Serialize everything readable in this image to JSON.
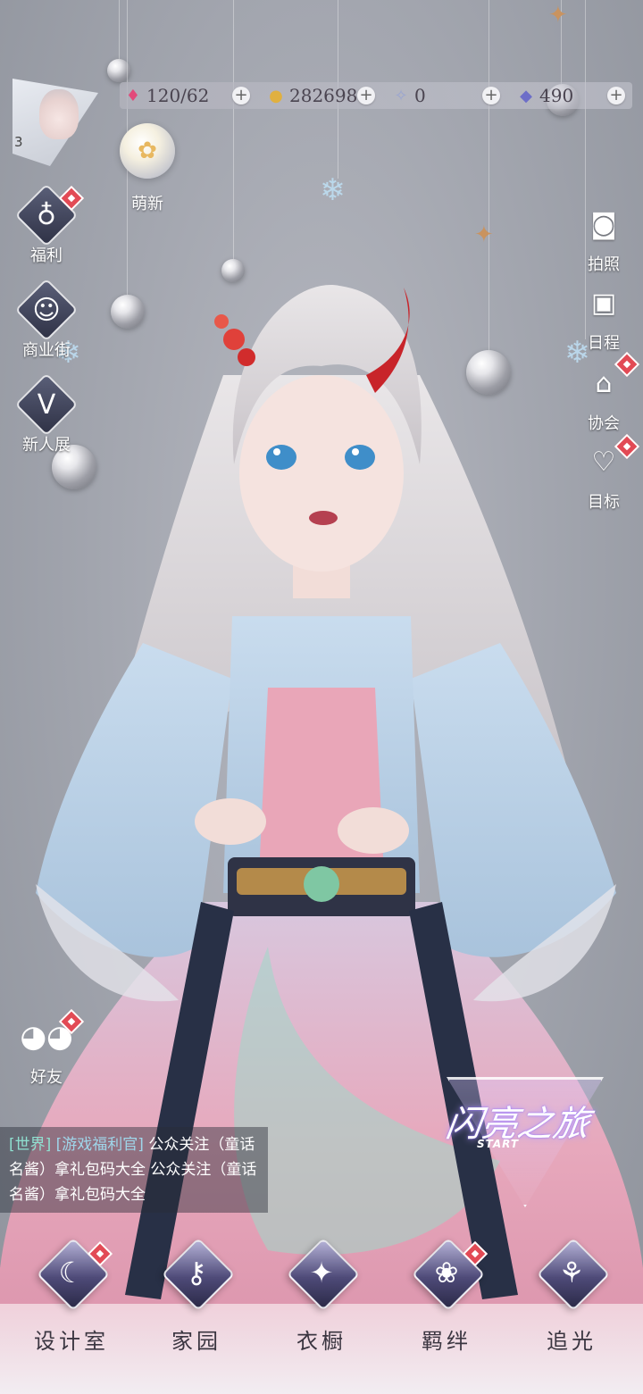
{
  "resources": {
    "stamina": {
      "icon": "heart-gem-icon",
      "value": "120/62"
    },
    "gold": {
      "icon": "gold-coin-icon",
      "value": "282698"
    },
    "crystal": {
      "icon": "crystal-icon",
      "value": "0"
    },
    "diamond": {
      "icon": "diamond-icon",
      "value": "490"
    },
    "plus": "+"
  },
  "player": {
    "level": "3"
  },
  "mengxin": {
    "label": "萌新"
  },
  "left_menu": [
    {
      "id": "fuli",
      "label": "福利",
      "icon": "hot-air-balloon-icon",
      "badge": true
    },
    {
      "id": "shangyejie",
      "label": "商业街",
      "icon": "shopping-bag-icon",
      "badge": false
    },
    {
      "id": "xinrenzhan",
      "label": "新人展",
      "icon": "trophy-v-icon",
      "badge": false
    }
  ],
  "right_menu": [
    {
      "id": "paizhao",
      "label": "拍照",
      "icon": "camera-icon",
      "badge": false
    },
    {
      "id": "richeng",
      "label": "日程",
      "icon": "calendar-icon",
      "badge": false
    },
    {
      "id": "xiehui",
      "label": "协会",
      "icon": "guild-hall-icon",
      "badge": true
    },
    {
      "id": "mubiao",
      "label": "目标",
      "icon": "bell-heart-icon",
      "badge": true
    }
  ],
  "friends": {
    "label": "好友",
    "icon": "friends-chat-icon",
    "badge": true
  },
  "chat": {
    "channel": "[世界]",
    "sender": "[游戏福利官]",
    "message": "公众关注（童话名酱）拿礼包码大全 公众关注（童话名酱）拿礼包码大全"
  },
  "journey": {
    "title": "闪亮之旅",
    "start": "START"
  },
  "bottom_nav": [
    {
      "id": "shejishi",
      "label": "设计室",
      "icon": "moon-pen-icon",
      "badge": true
    },
    {
      "id": "jiayuan",
      "label": "家园",
      "icon": "key-icon",
      "badge": false
    },
    {
      "id": "yichu",
      "label": "衣橱",
      "icon": "gem-wardrobe-icon",
      "badge": false
    },
    {
      "id": "jiban",
      "label": "羁绊",
      "icon": "flower-bond-icon",
      "badge": true
    },
    {
      "id": "zhuiguang",
      "label": "追光",
      "icon": "butterfly-icon",
      "badge": false
    }
  ],
  "colors": {
    "badge": "#e24a55",
    "background": "#a4a7b0",
    "chat_channel": "#8fe0d0"
  }
}
